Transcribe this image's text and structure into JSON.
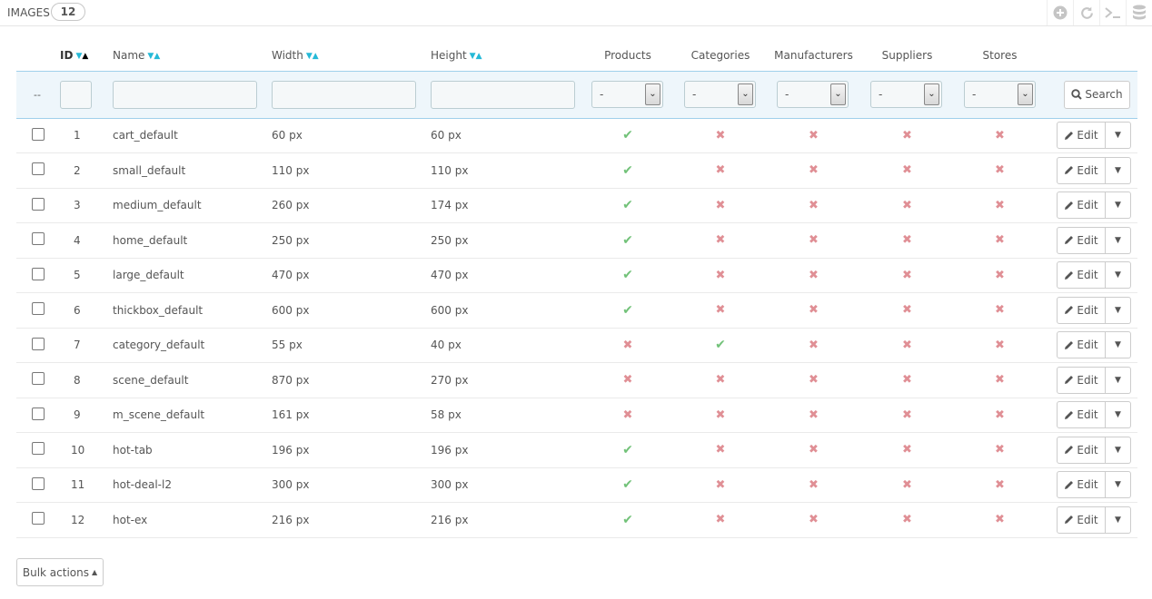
{
  "header": {
    "title": "IMAGES",
    "count": "12",
    "toolbar_icons": [
      "add-icon",
      "refresh-icon",
      "sql-query-icon",
      "export-database-icon"
    ]
  },
  "table": {
    "columns": [
      "ID",
      "Name",
      "Width",
      "Height",
      "Products",
      "Categories",
      "Manufacturers",
      "Suppliers",
      "Stores"
    ],
    "filter": {
      "dashdash": "--",
      "select_value": "-",
      "search_label": "Search"
    },
    "rows": [
      {
        "id": "1",
        "name": "cart_default",
        "width": "60 px",
        "height": "60 px",
        "products": true,
        "categories": false,
        "manufacturers": false,
        "suppliers": false,
        "stores": false
      },
      {
        "id": "2",
        "name": "small_default",
        "width": "110 px",
        "height": "110 px",
        "products": true,
        "categories": false,
        "manufacturers": false,
        "suppliers": false,
        "stores": false
      },
      {
        "id": "3",
        "name": "medium_default",
        "width": "260 px",
        "height": "174 px",
        "products": true,
        "categories": false,
        "manufacturers": false,
        "suppliers": false,
        "stores": false
      },
      {
        "id": "4",
        "name": "home_default",
        "width": "250 px",
        "height": "250 px",
        "products": true,
        "categories": false,
        "manufacturers": false,
        "suppliers": false,
        "stores": false
      },
      {
        "id": "5",
        "name": "large_default",
        "width": "470 px",
        "height": "470 px",
        "products": true,
        "categories": false,
        "manufacturers": false,
        "suppliers": false,
        "stores": false
      },
      {
        "id": "6",
        "name": "thickbox_default",
        "width": "600 px",
        "height": "600 px",
        "products": true,
        "categories": false,
        "manufacturers": false,
        "suppliers": false,
        "stores": false
      },
      {
        "id": "7",
        "name": "category_default",
        "width": "55 px",
        "height": "40 px",
        "products": false,
        "categories": true,
        "manufacturers": false,
        "suppliers": false,
        "stores": false
      },
      {
        "id": "8",
        "name": "scene_default",
        "width": "870 px",
        "height": "270 px",
        "products": false,
        "categories": false,
        "manufacturers": false,
        "suppliers": false,
        "stores": false
      },
      {
        "id": "9",
        "name": "m_scene_default",
        "width": "161 px",
        "height": "58 px",
        "products": false,
        "categories": false,
        "manufacturers": false,
        "suppliers": false,
        "stores": false
      },
      {
        "id": "10",
        "name": "hot-tab",
        "width": "196 px",
        "height": "196 px",
        "products": true,
        "categories": false,
        "manufacturers": false,
        "suppliers": false,
        "stores": false
      },
      {
        "id": "11",
        "name": "hot-deal-l2",
        "width": "300 px",
        "height": "300 px",
        "products": true,
        "categories": false,
        "manufacturers": false,
        "suppliers": false,
        "stores": false
      },
      {
        "id": "12",
        "name": "hot-ex",
        "width": "216 px",
        "height": "216 px",
        "products": true,
        "categories": false,
        "manufacturers": false,
        "suppliers": false,
        "stores": false
      }
    ],
    "edit_label": "Edit"
  },
  "footer": {
    "bulk_actions_label": "Bulk actions"
  },
  "colors": {
    "accent": "#25b9d7",
    "check": "#72c279",
    "cross": "#e08f95",
    "filter_bg": "#eef6fb"
  }
}
